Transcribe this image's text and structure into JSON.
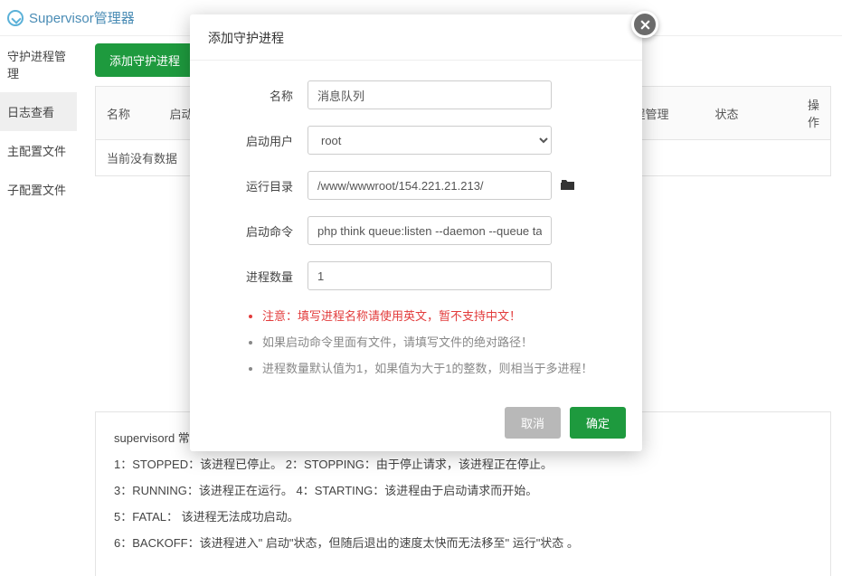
{
  "header": {
    "title": "Supervisor管理器"
  },
  "sidebar": {
    "items": [
      {
        "label": "守护进程管理"
      },
      {
        "label": "日志查看"
      },
      {
        "label": "主配置文件"
      },
      {
        "label": "子配置文件"
      }
    ],
    "active_index": 1
  },
  "toolbar": {
    "add_label": "添加守护进程"
  },
  "table": {
    "headers": {
      "name": "名称",
      "startcmd": "启动命",
      "mgmt": "程管理",
      "status": "状态",
      "action": "操作"
    },
    "empty_text": "当前没有数据"
  },
  "help": {
    "title": "supervisord 常见",
    "lines": [
      "1：STOPPED：该进程已停止。    2：STOPPING：由于停止请求，该进程正在停止。",
      "3：RUNNING：该进程正在运行。 4：STARTING：该进程由于启动请求而开始。",
      "5：FATAL： 该进程无法成功启动。",
      "6：BACKOFF：该进程进入\" 启动\"状态，但随后退出的速度太快而无法移至\" 运行\"状态 。"
    ]
  },
  "modal": {
    "title": "添加守护进程",
    "labels": {
      "name": "名称",
      "user": "启动用户",
      "dir": "运行目录",
      "cmd": "启动命令",
      "count": "进程数量"
    },
    "values": {
      "name": "消息队列",
      "user": "root",
      "dir": "/www/wwwroot/154.221.21.213/",
      "cmd": "php think queue:listen --daemon --queue task",
      "count": "1"
    },
    "notes": [
      "注意：填写进程名称请使用英文，暂不支持中文！",
      "如果启动命令里面有文件，请填写文件的绝对路径！",
      "进程数量默认值为1，如果值为大于1的整数，则相当于多进程！"
    ],
    "buttons": {
      "cancel": "取消",
      "confirm": "确定"
    }
  }
}
